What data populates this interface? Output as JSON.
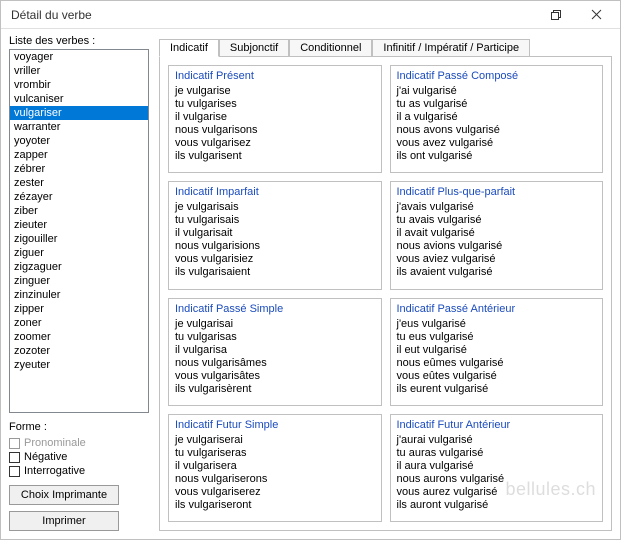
{
  "window": {
    "title": "Détail du verbe"
  },
  "left": {
    "list_label": "Liste des verbes :",
    "verbs": [
      "voyager",
      "vriller",
      "vrombir",
      "vulcaniser",
      "vulgariser",
      "warranter",
      "yoyoter",
      "zapper",
      "zébrer",
      "zester",
      "zézayer",
      "ziber",
      "zieuter",
      "zigouiller",
      "ziguer",
      "zigzaguer",
      "zinguer",
      "zinzinuler",
      "zipper",
      "zoner",
      "zoomer",
      "zozoter",
      "zyeuter"
    ],
    "selected_index": 4,
    "forme_label": "Forme :",
    "chk_pronominal": "Pronominale",
    "chk_negative": "Négative",
    "chk_interrogative": "Interrogative",
    "btn_printer": "Choix Imprimante",
    "btn_print": "Imprimer"
  },
  "tabs": {
    "items": [
      "Indicatif",
      "Subjonctif",
      "Conditionnel",
      "Infinitif / Impératif / Participe"
    ],
    "active_index": 0
  },
  "tenses": [
    {
      "title": "Indicatif Présent",
      "lines": [
        "je vulgarise",
        "tu vulgarises",
        "il vulgarise",
        "nous vulgarisons",
        "vous vulgarisez",
        "ils vulgarisent"
      ]
    },
    {
      "title": "Indicatif Passé Composé",
      "lines": [
        "j'ai vulgarisé",
        "tu as vulgarisé",
        "il a vulgarisé",
        "nous avons vulgarisé",
        "vous avez vulgarisé",
        "ils ont vulgarisé"
      ]
    },
    {
      "title": "Indicatif Imparfait",
      "lines": [
        "je vulgarisais",
        "tu vulgarisais",
        "il vulgarisait",
        "nous vulgarisions",
        "vous vulgarisiez",
        "ils vulgarisaient"
      ]
    },
    {
      "title": "Indicatif Plus-que-parfait",
      "lines": [
        "j'avais vulgarisé",
        "tu avais vulgarisé",
        "il avait vulgarisé",
        "nous avions vulgarisé",
        "vous aviez vulgarisé",
        "ils avaient vulgarisé"
      ]
    },
    {
      "title": "Indicatif Passé Simple",
      "lines": [
        "je vulgarisai",
        "tu vulgarisas",
        "il vulgarisa",
        "nous vulgarisâmes",
        "vous vulgarisâtes",
        "ils vulgarisèrent"
      ]
    },
    {
      "title": "Indicatif Passé Antérieur",
      "lines": [
        "j'eus vulgarisé",
        "tu eus vulgarisé",
        "il eut vulgarisé",
        "nous eûmes vulgarisé",
        "vous eûtes vulgarisé",
        "ils eurent vulgarisé"
      ]
    },
    {
      "title": "Indicatif Futur Simple",
      "lines": [
        "je vulgariserai",
        "tu vulgariseras",
        "il vulgarisera",
        "nous vulgariserons",
        "vous vulgariserez",
        "ils vulgariseront"
      ]
    },
    {
      "title": "Indicatif Futur Antérieur",
      "lines": [
        "j'aurai vulgarisé",
        "tu auras vulgarisé",
        "il aura vulgarisé",
        "nous aurons vulgarisé",
        "vous aurez vulgarisé",
        "ils auront vulgarisé"
      ]
    }
  ],
  "watermark": "bellules.ch"
}
